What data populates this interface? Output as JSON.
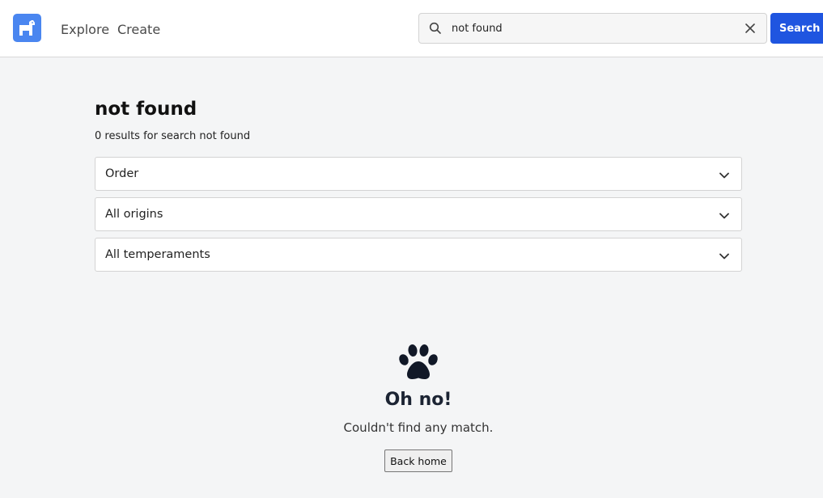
{
  "header": {
    "nav": [
      {
        "label": "Explore"
      },
      {
        "label": "Create"
      }
    ],
    "search": {
      "value": "not found",
      "placeholder": "",
      "button_label": "Search"
    }
  },
  "main": {
    "title": "not found",
    "result_count": "0 results for search not found",
    "filters": [
      {
        "label": "Order"
      },
      {
        "label": "All origins"
      },
      {
        "label": "All temperaments"
      }
    ]
  },
  "empty_state": {
    "icon": "paw-icon",
    "title": "Oh no!",
    "message": "Couldn't find any match.",
    "button_label": "Back home"
  },
  "colors": {
    "accent": "#1f55e0",
    "logo": "#4a86f0",
    "background": "#f4f5f6"
  }
}
